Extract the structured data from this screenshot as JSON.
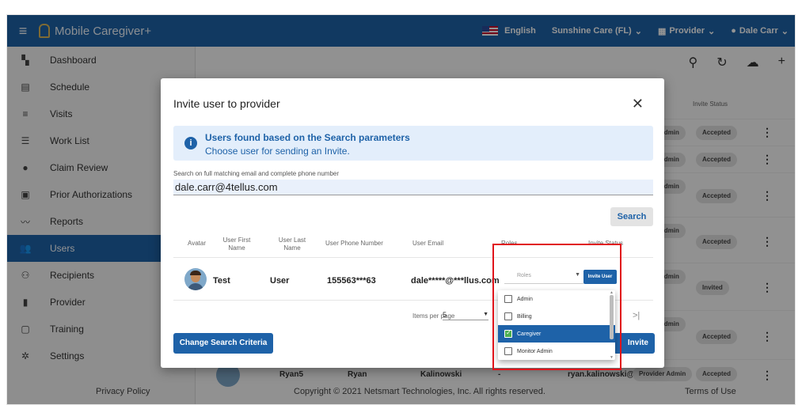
{
  "topbar": {
    "app_name": "Mobile Caregiver+",
    "language": "English",
    "agency": "Sunshine Care (FL)",
    "role": "Provider",
    "user": "Dale Carr"
  },
  "sidebar": {
    "items": [
      {
        "label": "Dashboard",
        "icon": "dashboard-icon"
      },
      {
        "label": "Schedule",
        "icon": "calendar-icon"
      },
      {
        "label": "Visits",
        "icon": "filter-icon"
      },
      {
        "label": "Work List",
        "icon": "list-icon"
      },
      {
        "label": "Claim Review",
        "icon": "alert-icon"
      },
      {
        "label": "Prior Authorizations",
        "icon": "calendar-check-icon"
      },
      {
        "label": "Reports",
        "icon": "chart-icon"
      },
      {
        "label": "Users",
        "icon": "users-icon",
        "active": true
      },
      {
        "label": "Recipients",
        "icon": "recipients-icon"
      },
      {
        "label": "Provider",
        "icon": "document-icon"
      },
      {
        "label": "Training",
        "icon": "training-icon"
      },
      {
        "label": "Settings",
        "icon": "gear-icon"
      }
    ]
  },
  "background_table": {
    "header_invite_status": "Invite Status",
    "rows": [
      {
        "role": "Admin",
        "status": "Accepted"
      },
      {
        "role": "Admin",
        "status": "Accepted"
      },
      {
        "role": "Admin",
        "status": "Accepted"
      },
      {
        "role": "Admin",
        "status": "Accepted"
      },
      {
        "role": "Admin",
        "status": "Invited"
      },
      {
        "role": "Admin",
        "status": "Accepted"
      }
    ],
    "last_row": {
      "username": "Ryan5",
      "first": "Ryan",
      "last": "Kalinowski",
      "phone": "-",
      "email": "ryan.kalinowski@...",
      "role": "Provider Admin",
      "status": "Accepted"
    }
  },
  "footer": {
    "privacy": "Privacy Policy",
    "copyright": "Copyright © 2021 Netsmart Technologies, Inc. All rights reserved.",
    "terms": "Terms of Use"
  },
  "modal": {
    "title": "Invite user to provider",
    "info_title": "Users found based on the Search parameters",
    "info_sub": "Choose user for sending an Invite.",
    "search_label": "Search on full matching email and complete phone number",
    "search_value": "dale.carr@4tellus.com",
    "search_button": "Search",
    "columns": {
      "avatar": "Avatar",
      "first": "User First Name",
      "last": "User Last Name",
      "phone": "User Phone Number",
      "email": "User Email",
      "roles": "Roles",
      "status": "Invite Status"
    },
    "result": {
      "first": "Test",
      "last": "User",
      "phone": "155563***63",
      "email": "dale*****@***llus.com"
    },
    "roles_placeholder": "Roles",
    "invite_small": "Invite User",
    "items_per_page_label": "Items per page",
    "items_per_page_value": "5",
    "pager_last": ">|",
    "change_button": "Change Search Criteria",
    "invite_button": "Invite User"
  },
  "roles_dropdown": [
    {
      "label": "Admin",
      "checked": false
    },
    {
      "label": "Billing",
      "checked": false
    },
    {
      "label": "Caregiver",
      "checked": true
    },
    {
      "label": "Monitor Admin",
      "checked": false
    }
  ]
}
